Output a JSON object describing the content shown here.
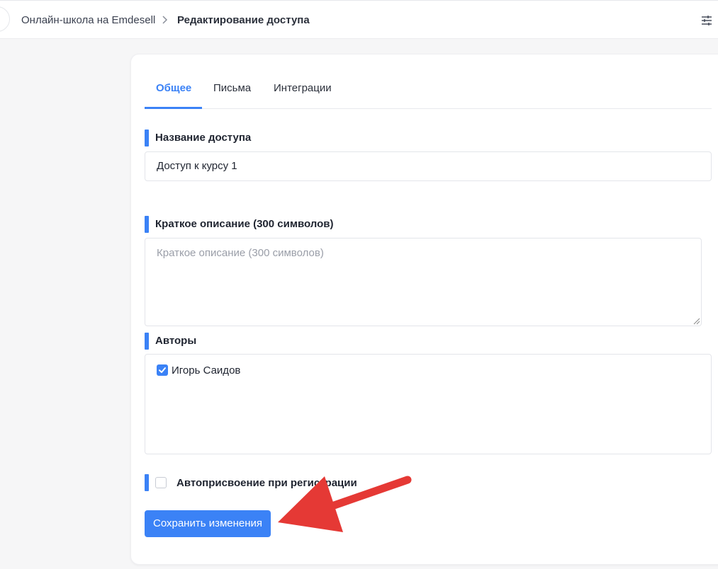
{
  "breadcrumb": {
    "parent": "Онлайн-школа на Emdesell",
    "current": "Редактирование доступа"
  },
  "tabs": [
    {
      "label": "Общее",
      "active": true
    },
    {
      "label": "Письма",
      "active": false
    },
    {
      "label": "Интеграции",
      "active": false
    }
  ],
  "form": {
    "name_label": "Название доступа",
    "name_value": "Доступ к курсу 1",
    "description_label": "Краткое описание (300 символов)",
    "description_placeholder": "Краткое описание (300 символов)",
    "authors_label": "Авторы",
    "authors": [
      {
        "name": "Игорь Саидов",
        "checked": true
      }
    ],
    "auto_assign_label": "Автоприсвоение при регистрации",
    "auto_assign_checked": false,
    "save_label": "Сохранить изменения"
  },
  "colors": {
    "accent": "#3b82f6",
    "annotation_arrow": "#e53935"
  },
  "icons": {
    "breadcrumb_separator": "chevron-right-icon",
    "settings": "sliders-icon",
    "checkbox": "check-icon"
  }
}
